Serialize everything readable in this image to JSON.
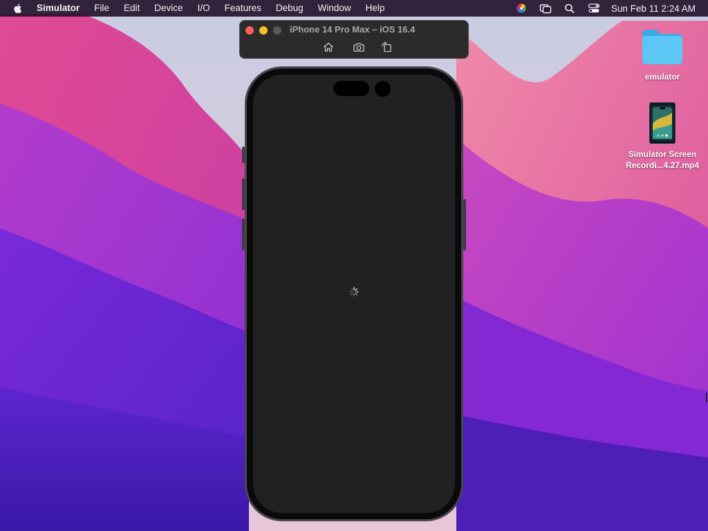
{
  "menubar": {
    "app_name": "Simulator",
    "items": [
      "File",
      "Edit",
      "Device",
      "I/O",
      "Features",
      "Debug",
      "Window",
      "Help"
    ],
    "status_icons": [
      "color-wheel-icon",
      "screen-mirroring-icon",
      "search-icon",
      "control-center-icon"
    ],
    "clock": "Sun Feb 11  2:24 AM"
  },
  "simulator": {
    "title": "iPhone 14 Pro Max – iOS 16.4",
    "toolbar": [
      "home-icon",
      "screenshot-icon",
      "rotate-icon"
    ],
    "screen_state": "loading"
  },
  "desktop": {
    "folder": {
      "label": "emulator",
      "icon": "folder-icon"
    },
    "recording": {
      "label_line1": "Simulator Screen",
      "label_line2": "Recordi...4.27.mp4",
      "icon": "video-thumbnail-icon"
    }
  },
  "colors": {
    "traffic_close": "#ff5f57",
    "traffic_minimize": "#febc2e",
    "traffic_zoom": "#58585a",
    "screen_background": "#212023",
    "folder_blue": "#5cc7f5"
  }
}
